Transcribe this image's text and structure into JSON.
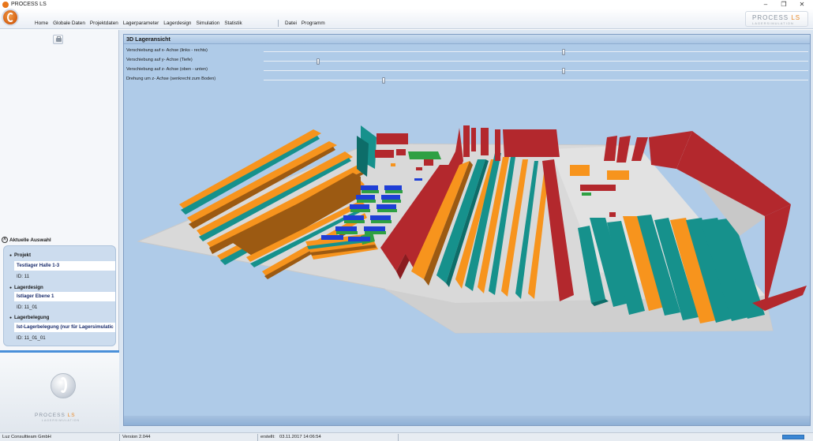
{
  "window": {
    "title": "PROCESS LS"
  },
  "menu": {
    "items": [
      "Home",
      "Globale Daten",
      "Projektdaten",
      "Lagerparameter",
      "Lagerdesign",
      "Simulation",
      "Statistik"
    ],
    "items_right": [
      "Datei",
      "Programm"
    ]
  },
  "brand": {
    "name_main": "PROCESS ",
    "name_ls": "LS",
    "subtitle": "LAGERSIMULATION"
  },
  "view": {
    "title": "3D Lageransicht",
    "sliders": [
      {
        "label": "Verschiebung auf x- Achse (links - rechts)",
        "value": 0.55
      },
      {
        "label": "Verschiebung auf y- Achse (Tiefe)",
        "value": 0.1
      },
      {
        "label": "Verschiebung auf z- Achse (oben - unten)",
        "value": 0.55
      },
      {
        "label": "Drehung um z- Achse (senkrecht zum Boden)",
        "value": 0.22
      }
    ]
  },
  "selection": {
    "header": "Aktuelle Auswahl",
    "groups": [
      {
        "title": "Projekt",
        "value": "Testlager Halle 1-3",
        "id": "ID: 11"
      },
      {
        "title": "Lagerdesign",
        "value": "Istlager Ebene 1",
        "id": "ID: 11_01"
      },
      {
        "title": "Lagerbelegung",
        "value": "Ist-Lagerbelegung (nur für Lagersimulatic",
        "id": "ID: 11_01_01"
      }
    ]
  },
  "logo": {
    "name_main": "PROCESS ",
    "name_ls": "LS",
    "subtitle": "LAGERSIMULATION"
  },
  "status": {
    "company": "Luz Consultteam GmbH",
    "version": "Version 2.044",
    "created_label": "erstellt:",
    "created_value": "03.11.2017 14:06:54"
  },
  "colors": {
    "accent_orange": "#f7941d",
    "rack_teal": "#16918c",
    "rack_red": "#b3282d",
    "rack_brown": "#9c5a12",
    "rack_green": "#2ea043",
    "rack_blue": "#1f3fd6",
    "floor": "#d9d9d9",
    "viewport_bg": "#afcbe8"
  }
}
